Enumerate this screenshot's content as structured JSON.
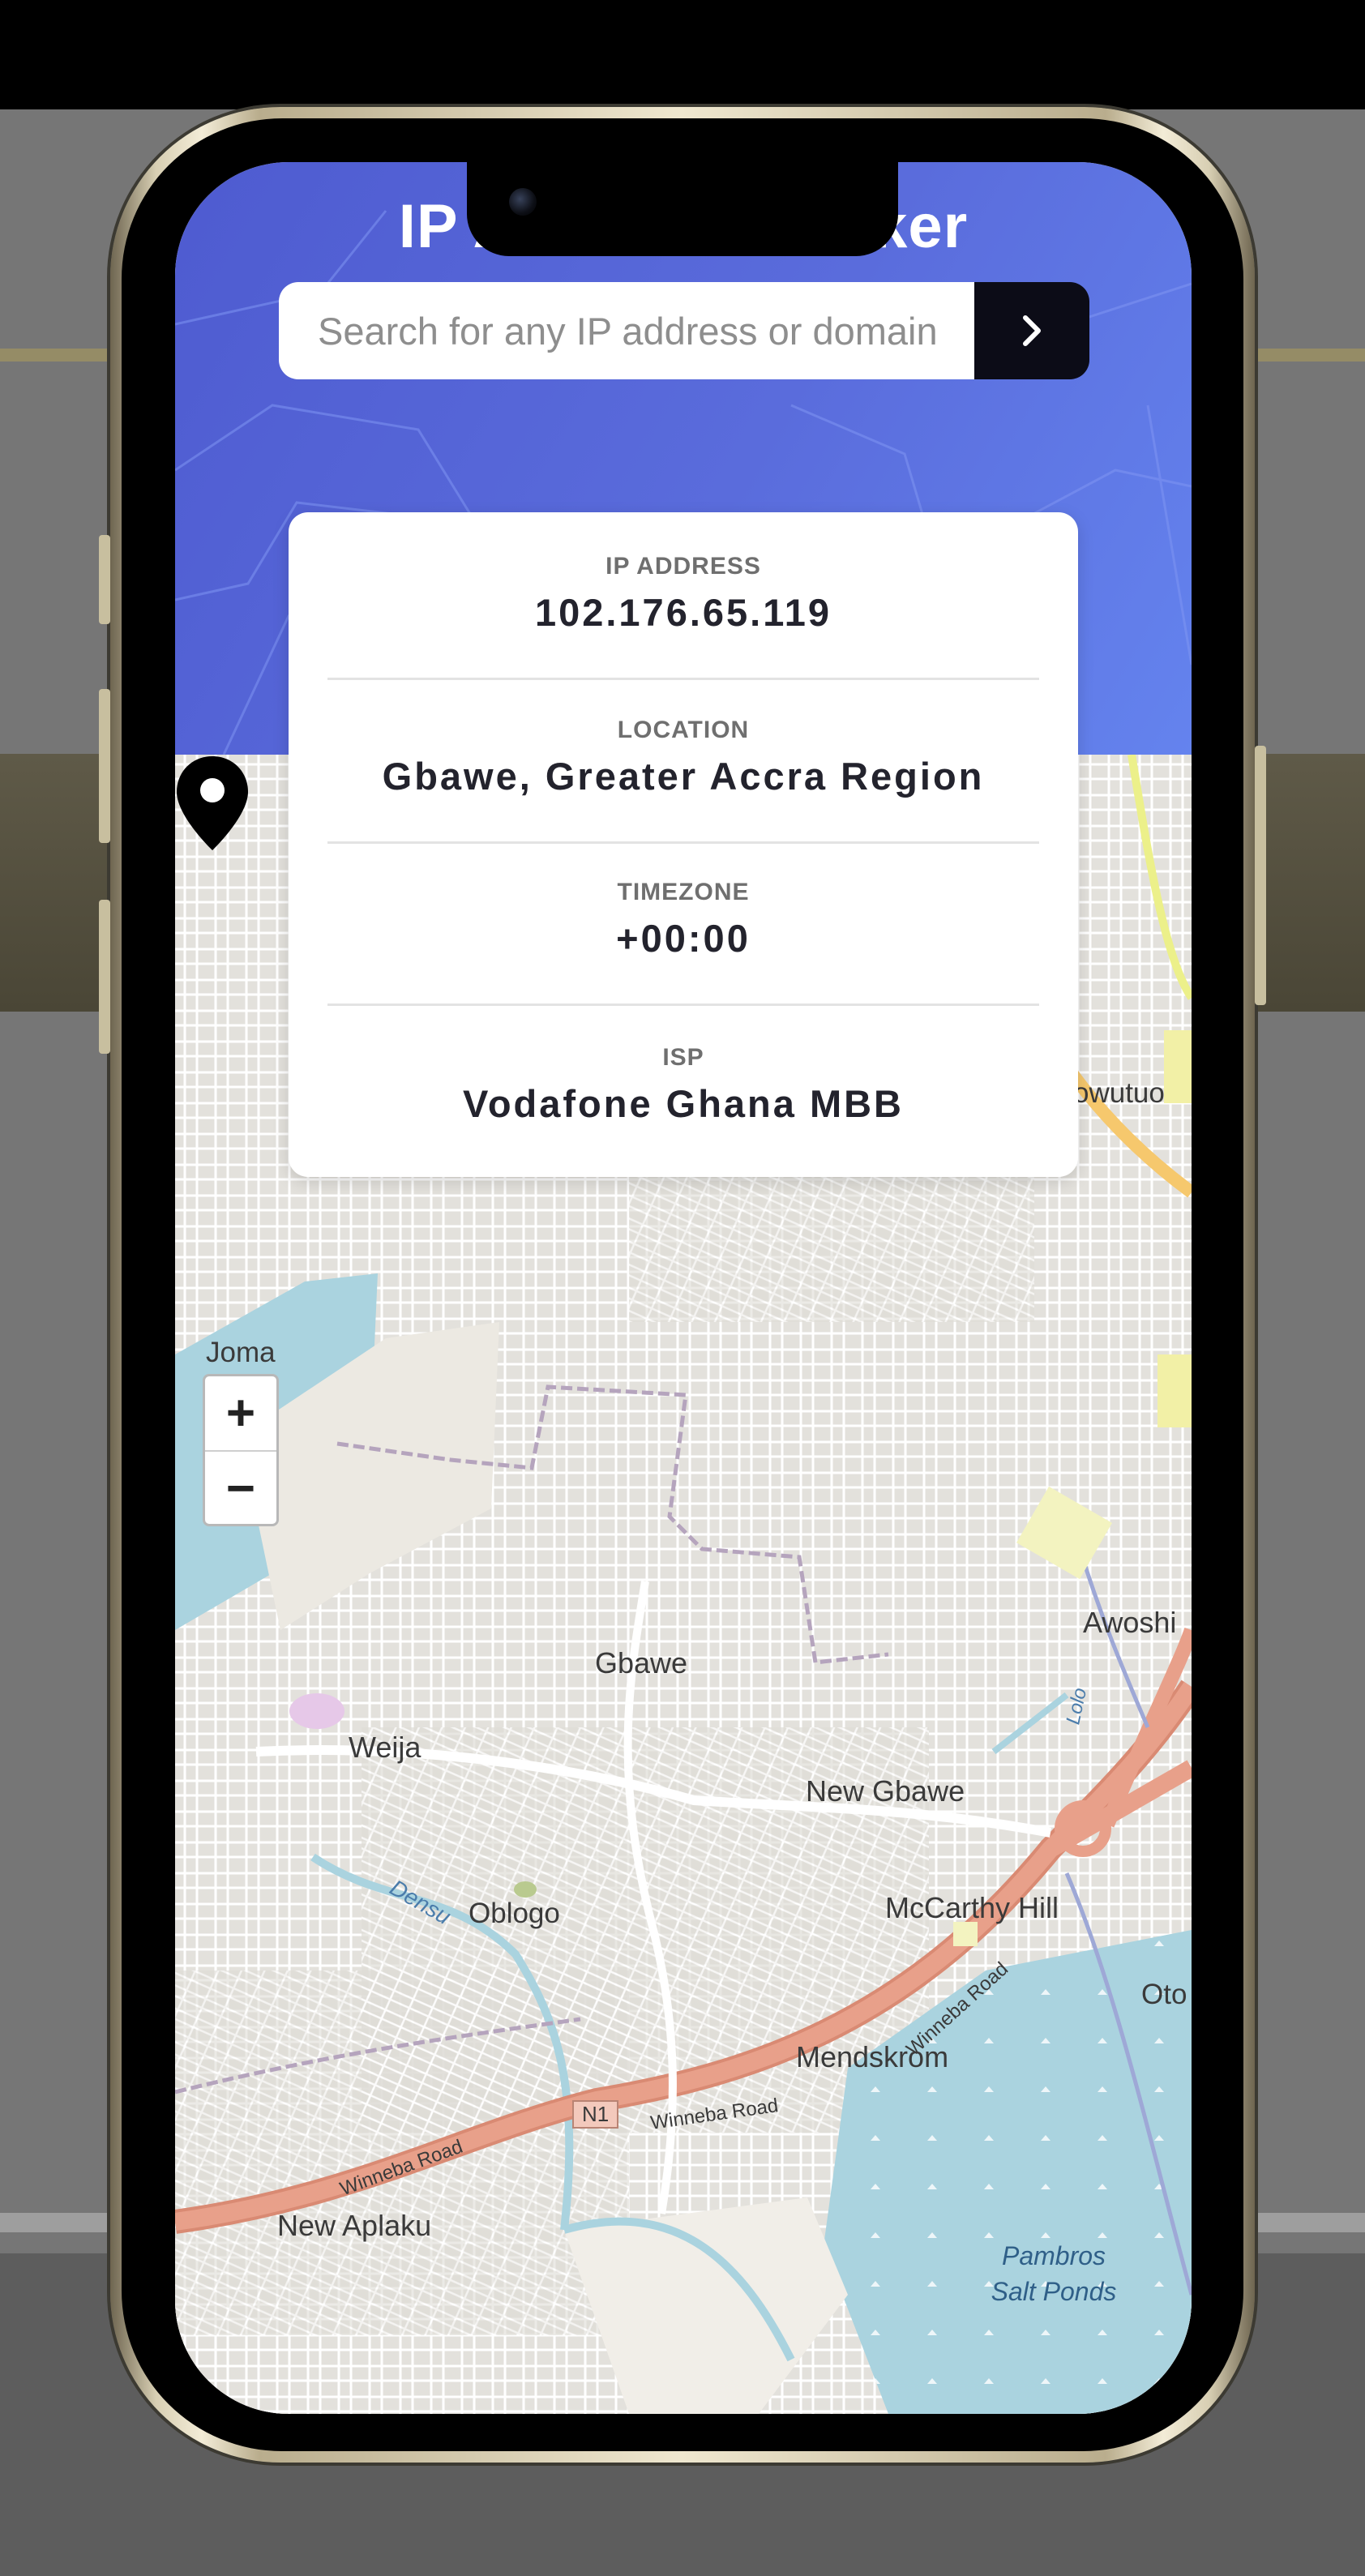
{
  "app": {
    "title": "IP Address Tracker"
  },
  "search": {
    "placeholder": "Search for any IP address or domain",
    "submit_icon": "chevron-right-icon"
  },
  "info": {
    "ip_label": "IP ADDRESS",
    "ip_value": "102.176.65.119",
    "location_label": "LOCATION",
    "location_value": "Gbawe, Greater Accra Region",
    "timezone_label": "TIMEZONE",
    "timezone_value": "+00:00",
    "isp_label": "ISP",
    "isp_value": "Vodafone Ghana MBB"
  },
  "map": {
    "zoom_in": "+",
    "zoom_out": "−",
    "marker_icon": "map-pin-icon",
    "labels": {
      "joma": "Joma",
      "owutuo": "owutuo",
      "awoshie": "Awoshi",
      "gbawe": "Gbawe",
      "weija": "Weija",
      "new_gbawe": "New Gbawe",
      "oblogo": "Oblogo",
      "densu": "Densu",
      "mccarthy_hill": "McCarthy Hill",
      "oto": "Oto",
      "mendskrom": "Mendskrom",
      "n1": "N1",
      "winneba_road_1": "Winneba Road",
      "winneba_road_2": "Winneba Road",
      "winneba_road_3": "Winneba Road",
      "new_aplaku": "New Aplaku",
      "pambros": "Pambros\nSalt Ponds",
      "lolo": "Lolo"
    }
  },
  "colors": {
    "header_gradient_start": "#4e5bd0",
    "header_gradient_end": "#6483ee",
    "search_button": "#0c0c17",
    "card_value_text": "#23232d",
    "map_water": "#aad3df",
    "map_road_major": "#e8927c"
  }
}
